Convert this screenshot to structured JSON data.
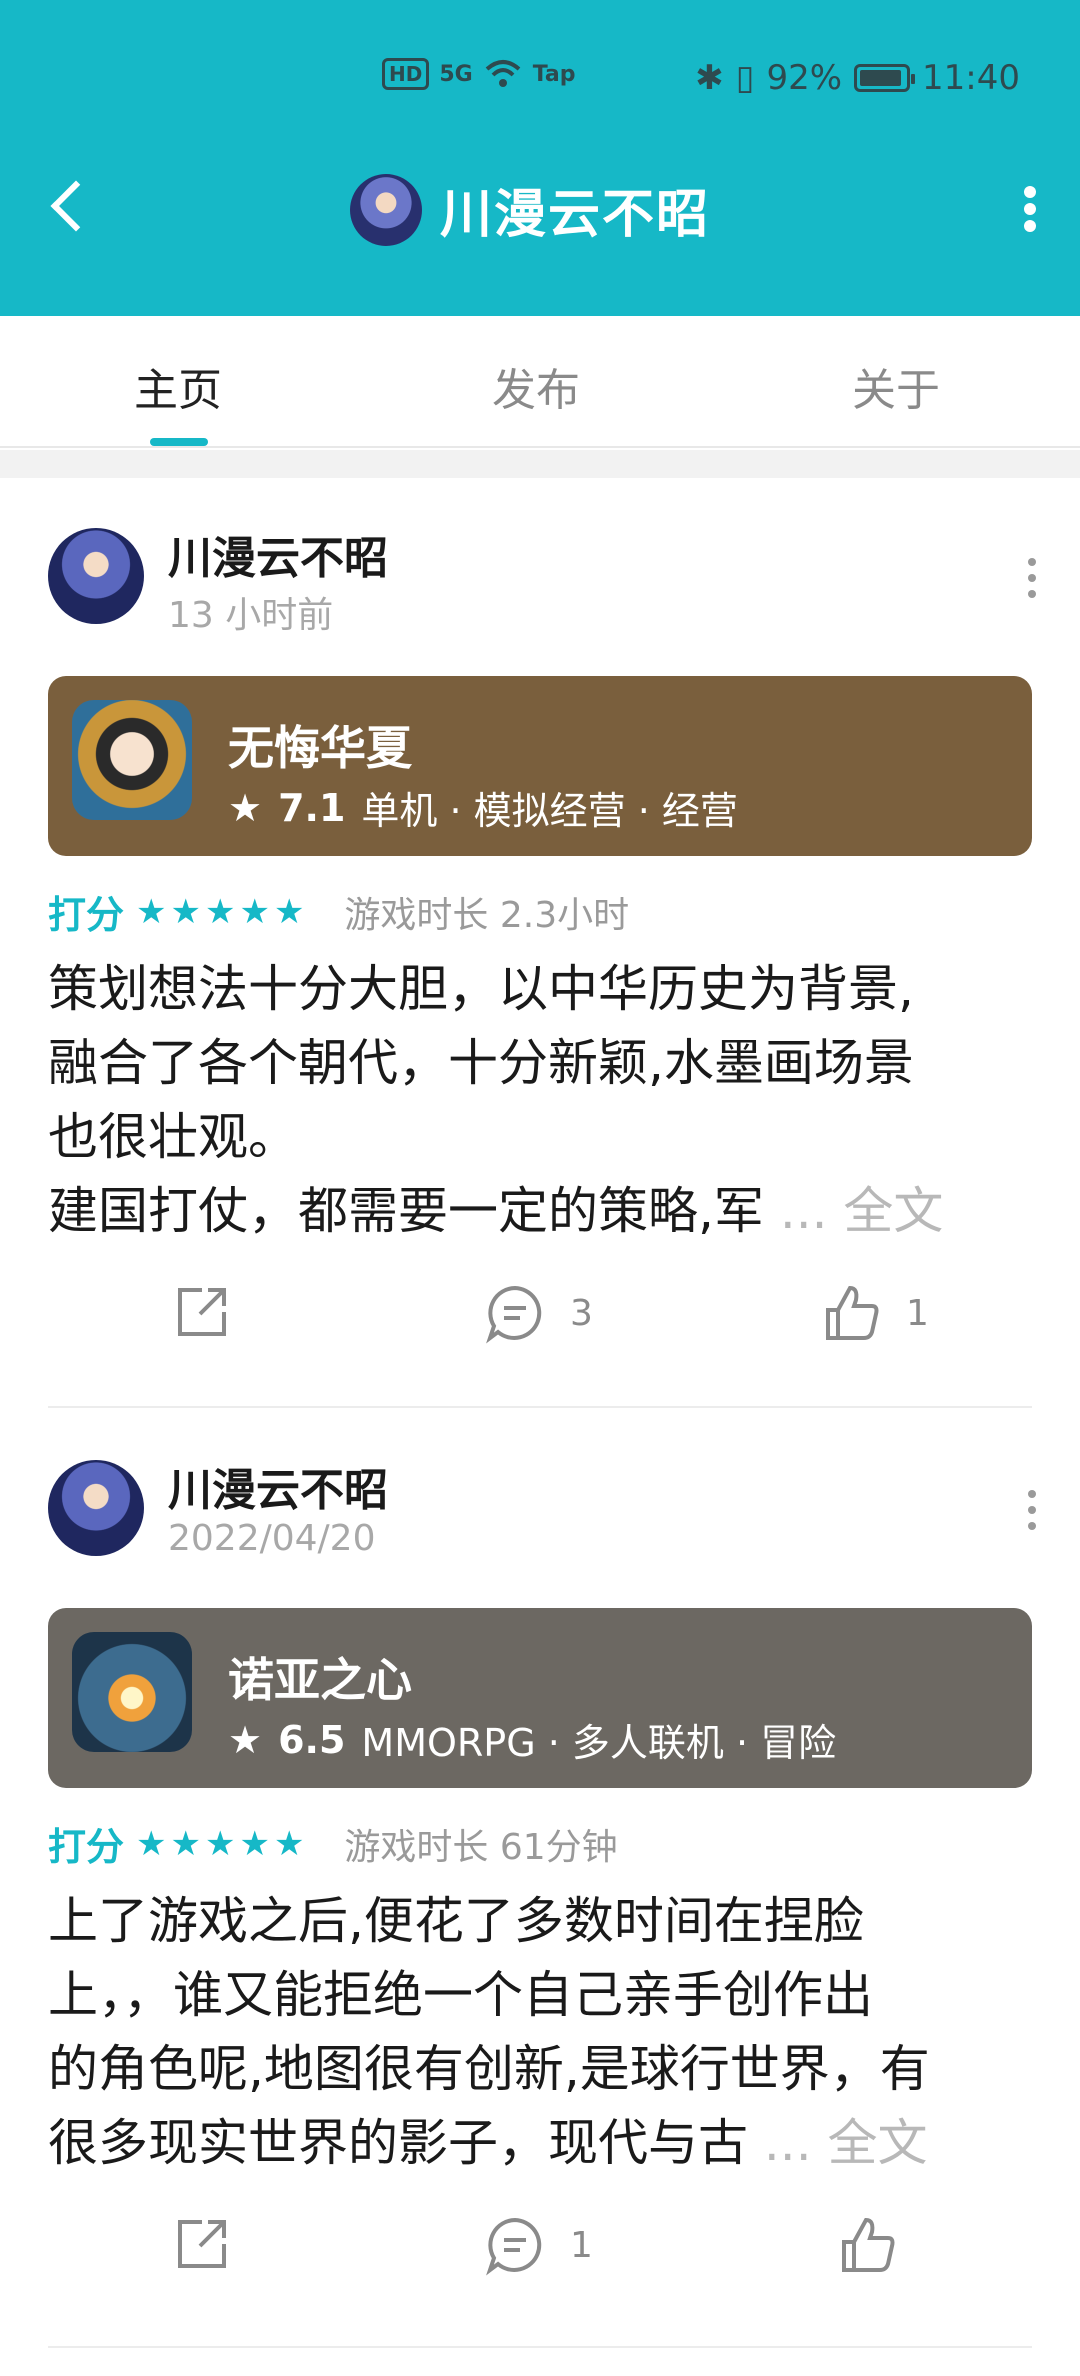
{
  "status_bar": {
    "network": "HD",
    "signal": "5G",
    "wifi_label": "Tap",
    "battery": "92%",
    "time": "11:40"
  },
  "header": {
    "title": "川漫云不昭"
  },
  "tabs": [
    {
      "label": "主页",
      "active": true
    },
    {
      "label": "发布",
      "active": false
    },
    {
      "label": "关于",
      "active": false
    }
  ],
  "posts": [
    {
      "username": "川漫云不昭",
      "time": "13 小时前",
      "game": {
        "name": "无悔华夏",
        "score": "7.1",
        "tags": "单机 · 模拟经营 · 经营",
        "bg_color": "#7a5f3d"
      },
      "rating_label": "打分",
      "stars": "★★★★★",
      "playtime": "游戏时长 2.3小时",
      "review_lines": [
        "策划想法十分大胆，以中华历史为背景,",
        "融合了各个朝代，十分新颖,水墨画场景",
        "也很壮观。",
        "建国打仗，都需要一定的策略,军"
      ],
      "ellipsis": "... 全文",
      "comments": "3",
      "likes": "1"
    },
    {
      "username": "川漫云不昭",
      "time": "2022/04/20",
      "game": {
        "name": "诺亚之心",
        "score": "6.5",
        "tags": "MMORPG · 多人联机 · 冒险",
        "bg_color": "#6c6862"
      },
      "rating_label": "打分",
      "stars": "★★★★★",
      "playtime": "游戏时长 61分钟",
      "review_lines": [
        "上了游戏之后,便花了多数时间在捏脸",
        "上，，谁又能拒绝一个自己亲手创作出",
        "的角色呢,地图很有创新,是球行世界，有",
        "很多现实世界的影子，现代与古"
      ],
      "ellipsis": "... 全文",
      "comments": "1",
      "likes": ""
    }
  ]
}
